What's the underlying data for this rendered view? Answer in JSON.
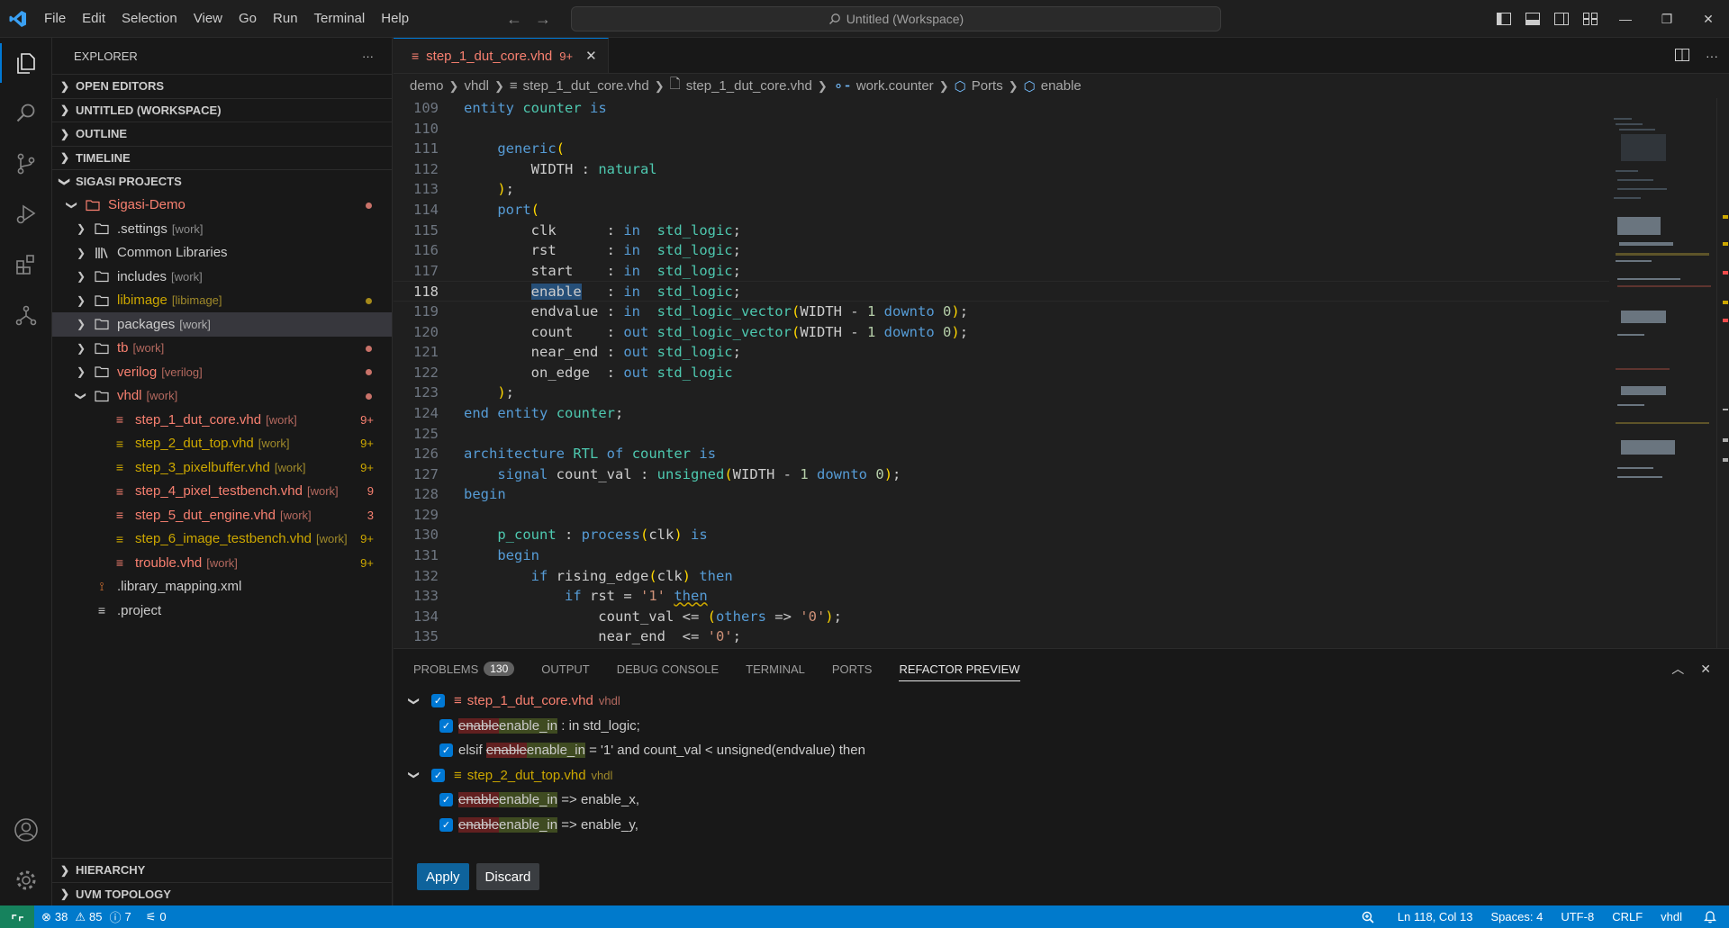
{
  "titlebar": {
    "menu": [
      "File",
      "Edit",
      "Selection",
      "View",
      "Go",
      "Run",
      "Terminal",
      "Help"
    ],
    "command_center": "Untitled (Workspace)"
  },
  "sidebar": {
    "title": "EXPLORER",
    "more": "···",
    "sections_top": [
      "OPEN EDITORS",
      "UNTITLED (WORKSPACE)",
      "OUTLINE",
      "TIMELINE",
      "SIGASI PROJECTS"
    ],
    "tree": [
      {
        "label": "Sigasi-Demo",
        "suffix": "",
        "badge": ""
      },
      {
        "label": ".settings",
        "suffix": "[work]",
        "badge": ""
      },
      {
        "label": "Common Libraries",
        "suffix": "",
        "badge": ""
      },
      {
        "label": "includes",
        "suffix": "[work]",
        "badge": ""
      },
      {
        "label": "libimage",
        "suffix": "[libimage]",
        "badge": ""
      },
      {
        "label": "packages",
        "suffix": "[work]",
        "badge": ""
      },
      {
        "label": "tb",
        "suffix": "[work]",
        "badge": ""
      },
      {
        "label": "verilog",
        "suffix": "[verilog]",
        "badge": ""
      },
      {
        "label": "vhdl",
        "suffix": "[work]",
        "badge": ""
      },
      {
        "label": "step_1_dut_core.vhd",
        "suffix": "[work]",
        "badge": "9+"
      },
      {
        "label": "step_2_dut_top.vhd",
        "suffix": "[work]",
        "badge": "9+"
      },
      {
        "label": "step_3_pixelbuffer.vhd",
        "suffix": "[work]",
        "badge": "9+"
      },
      {
        "label": "step_4_pixel_testbench.vhd",
        "suffix": "[work]",
        "badge": "9"
      },
      {
        "label": "step_5_dut_engine.vhd",
        "suffix": "[work]",
        "badge": "3"
      },
      {
        "label": "step_6_image_testbench.vhd",
        "suffix": "[work]",
        "badge": "9+"
      },
      {
        "label": "trouble.vhd",
        "suffix": "[work]",
        "badge": "9+"
      },
      {
        "label": ".library_mapping.xml",
        "suffix": "",
        "badge": ""
      },
      {
        "label": ".project",
        "suffix": "",
        "badge": ""
      }
    ],
    "sections_bottom": [
      "HIERARCHY",
      "UVM TOPOLOGY"
    ]
  },
  "editor": {
    "tab": {
      "label": "step_1_dut_core.vhd",
      "count": "9+",
      "close": "✕"
    },
    "breadcrumbs": [
      "demo",
      "vhdl",
      "step_1_dut_core.vhd",
      "step_1_dut_core.vhd",
      "work.counter",
      "Ports",
      "enable"
    ],
    "line_numbers": [
      "109",
      "110",
      "111",
      "112",
      "113",
      "114",
      "115",
      "116",
      "117",
      "118",
      "119",
      "120",
      "121",
      "122",
      "123",
      "124",
      "125",
      "126",
      "127",
      "128",
      "129",
      "130",
      "131",
      "132",
      "133",
      "134",
      "135"
    ],
    "current_line": "118"
  },
  "panel": {
    "tabs": [
      {
        "label": "PROBLEMS",
        "count": "130"
      },
      {
        "label": "OUTPUT"
      },
      {
        "label": "DEBUG CONSOLE"
      },
      {
        "label": "TERMINAL"
      },
      {
        "label": "PORTS"
      },
      {
        "label": "REFACTOR PREVIEW"
      }
    ],
    "files": [
      {
        "name": "step_1_dut_core.vhd",
        "folder": "vhdl",
        "changes": [
          {
            "pre": "",
            "old": "enable",
            "new": "enable_in",
            "post": " : in std_logic;"
          },
          {
            "pre": "elsif ",
            "old": "enable",
            "new": "enable_in",
            "post": " = '1' and count_val < unsigned(endvalue) then"
          }
        ]
      },
      {
        "name": "step_2_dut_top.vhd",
        "folder": "vhdl",
        "changes": [
          {
            "pre": "",
            "old": "enable",
            "new": "enable_in",
            "post": " => enable_x,"
          },
          {
            "pre": "",
            "old": "enable",
            "new": "enable_in",
            "post": " => enable_y,"
          }
        ]
      }
    ],
    "apply_label": "Apply",
    "discard_label": "Discard"
  },
  "statusbar": {
    "errors": "38",
    "warnings": "85",
    "infos": "7",
    "ports": "0",
    "position": "Ln 118, Col 13",
    "spaces": "Spaces: 4",
    "encoding": "UTF-8",
    "eol": "CRLF",
    "language": "vhdl"
  },
  "colors": {
    "accent": "#0078d4",
    "statusbar": "#007acc",
    "error_file": "#f88070",
    "warning_file": "#cca700"
  }
}
